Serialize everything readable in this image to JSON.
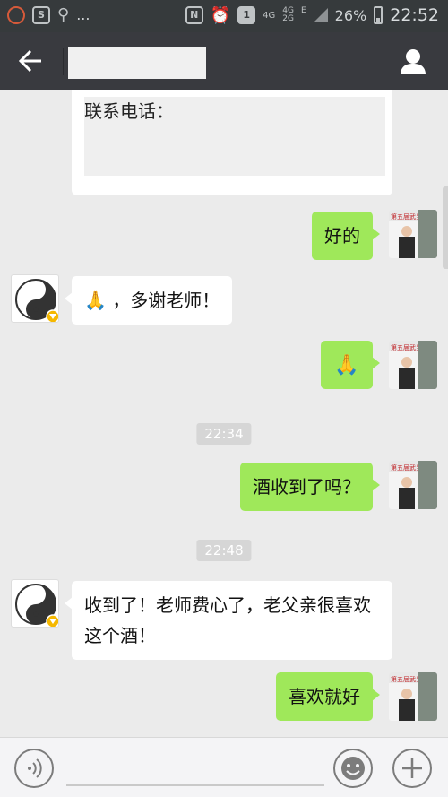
{
  "status_bar": {
    "network_4g": "4G",
    "network_4g_small": "4G",
    "network_2g_small": "2G",
    "network_e": "E",
    "dots": "...",
    "battery_percent": "26%",
    "time": "22:52",
    "sim_badge": "1",
    "nfc_badge": "N"
  },
  "header": {
    "title": ""
  },
  "contact_card": {
    "label": "联系电话："
  },
  "messages": [
    {
      "side": "me",
      "text": "好的"
    },
    {
      "side": "them",
      "text": "，多谢老师！",
      "emoji": "clasped-hands"
    },
    {
      "side": "me",
      "text": "",
      "emoji": "clasped-hands"
    },
    {
      "side": "time",
      "text": "22:34"
    },
    {
      "side": "me",
      "text": "酒收到了吗？"
    },
    {
      "side": "time",
      "text": "22:48"
    },
    {
      "side": "them",
      "text": "收到了！老师费心了，老父亲很喜欢这个酒！"
    },
    {
      "side": "me",
      "text": "喜欢就好"
    }
  ],
  "input_bar": {
    "placeholder": ""
  },
  "colors": {
    "my_bubble": "#9fe85a",
    "their_bubble": "#ffffff",
    "background": "#ebebeb",
    "header": "#393a3f"
  }
}
